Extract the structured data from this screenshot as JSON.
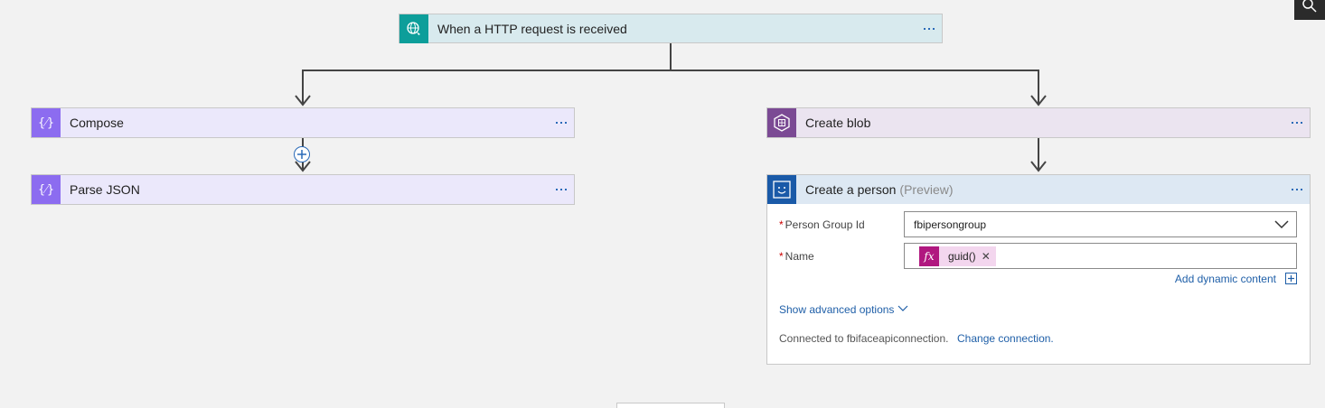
{
  "trigger": {
    "title": "When a HTTP request is received",
    "icon": "globe-icon"
  },
  "compose": {
    "title": "Compose",
    "icon": "code-braces-icon"
  },
  "parse_json": {
    "title": "Parse JSON",
    "icon": "code-braces-icon"
  },
  "create_blob": {
    "title": "Create blob",
    "icon": "blob-storage-icon"
  },
  "create_person": {
    "title": "Create a person",
    "preview": "(Preview)",
    "icon": "face-icon",
    "fields": {
      "person_group_label": "Person Group Id",
      "person_group_value": "fbipersongroup",
      "name_label": "Name",
      "name_token": "guid()",
      "required_mark": "*"
    },
    "add_dynamic_content": "Add dynamic content",
    "show_advanced": "Show advanced options",
    "connected_to": "Connected to fbifaceapiconnection.",
    "change_connection": "Change connection."
  },
  "colors": {
    "trigger_header": "#d8eaee",
    "trigger_icon": "#0d9e9a",
    "compose_header": "#ebe8fb",
    "compose_icon": "#8c6cf0",
    "blob_header": "#ebe4f0",
    "blob_icon": "#7b4a94",
    "face_header": "#dde8f3",
    "face_icon": "#1a5aa8",
    "token_bg": "#f3d6ee",
    "token_fx": "#b0177f"
  }
}
